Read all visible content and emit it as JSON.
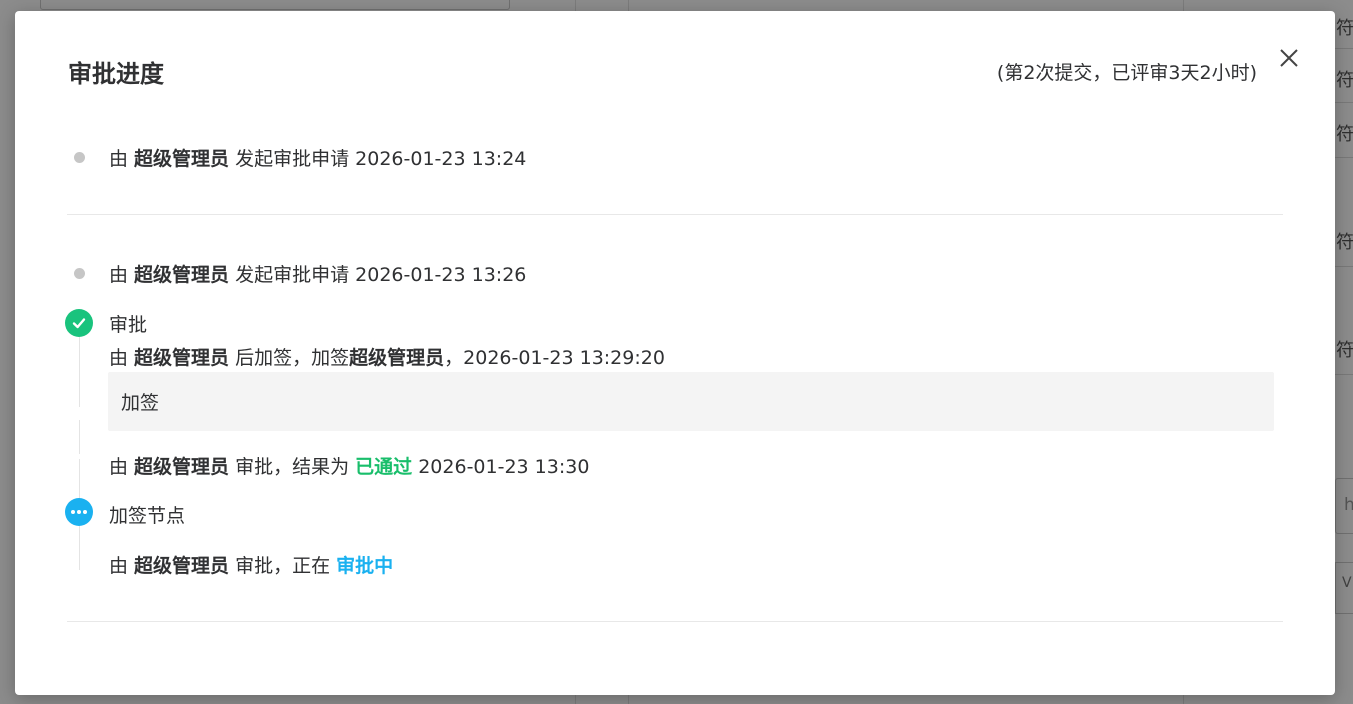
{
  "background": {
    "right_cells": [
      "符",
      "符",
      "符",
      "符",
      "符"
    ],
    "input_partial": "h",
    "select_partial": "ᐯ"
  },
  "modal": {
    "title": "审批进度",
    "subtitle": "(第2次提交，已评审3天2小时)",
    "close_icon": "close-icon"
  },
  "timeline_group_1": {
    "submit": {
      "prefix": "由 ",
      "user": "超级管理员",
      "action": " 发起审批申请 ",
      "time": "2026-01-23 13:24"
    }
  },
  "timeline_group_2": {
    "submit": {
      "prefix": "由 ",
      "user": "超级管理员",
      "action": " 发起审批申请 ",
      "time": "2026-01-23 13:26"
    },
    "node_approve": {
      "title": "审批",
      "icon": "check-icon",
      "countersign": {
        "prefix": "由 ",
        "user": "超级管理员",
        "action": " 后加签，加签",
        "target_user": "超级管理员",
        "sep": "，",
        "time": "2026-01-23 13:29:20"
      },
      "comment": "加签",
      "result": {
        "prefix": "由 ",
        "user": "超级管理员",
        "action": " 审批，结果为 ",
        "status": "已通过",
        "time": " 2026-01-23 13:30"
      }
    },
    "node_countersign": {
      "title": "加签节点",
      "icon": "more-icon",
      "progress": {
        "prefix": "由 ",
        "user": "超级管理员",
        "action": " 审批，正在 ",
        "status": "审批中"
      }
    }
  },
  "colors": {
    "pass": "#19be6b",
    "pending": "#1ab1f0",
    "check_icon_bg": "#19c37d"
  }
}
